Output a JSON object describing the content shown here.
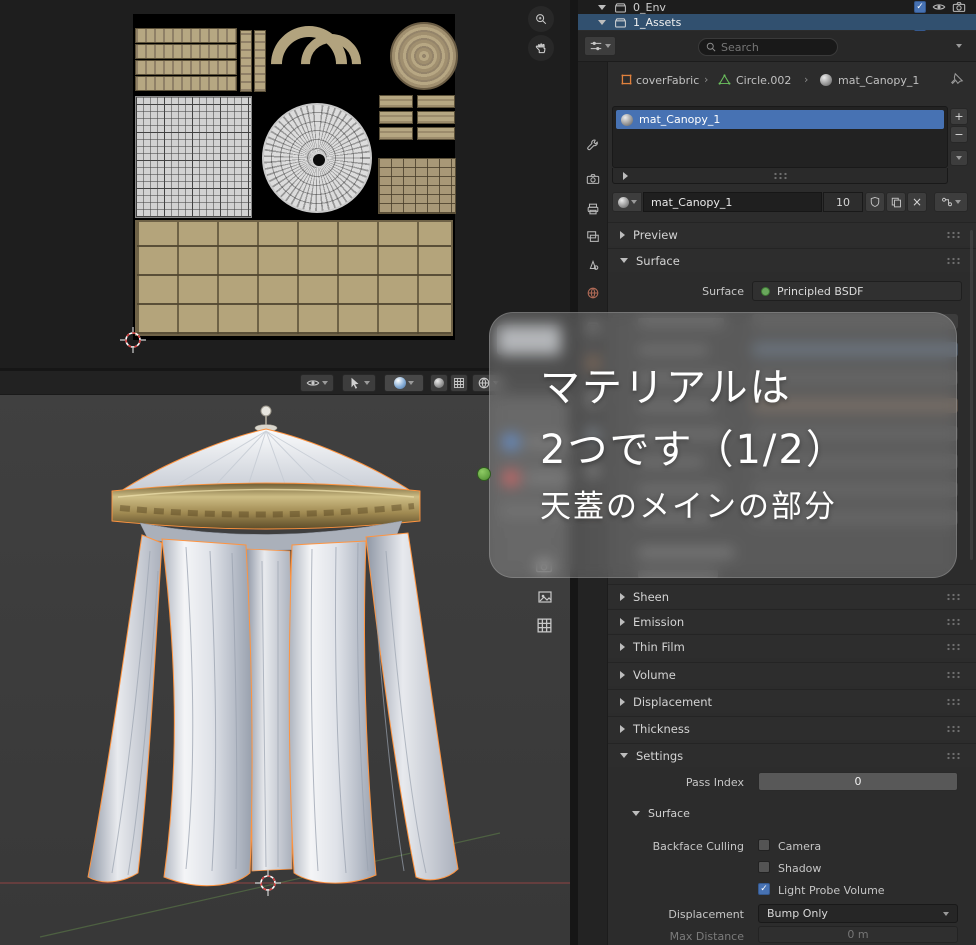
{
  "outliner": {
    "env_label": "0_Env",
    "assets_label": "1_Assets"
  },
  "header": {
    "search_placeholder": "Search"
  },
  "breadcrumb": {
    "object": "coverFabric",
    "mesh": "Circle.002",
    "material": "mat_Canopy_1",
    "separator": "›"
  },
  "slots": {
    "selected": "mat_Canopy_1"
  },
  "datablock": {
    "name": "mat_Canopy_1",
    "users": "10"
  },
  "icons": {
    "check": "✓",
    "plus": "+",
    "minus": "−",
    "close": "×"
  },
  "panels": {
    "preview": "Preview",
    "surface": "Surface",
    "sheen": "Sheen",
    "emission": "Emission",
    "thin_film": "Thin Film",
    "volume": "Volume",
    "displacement": "Displacement",
    "thickness": "Thickness",
    "settings": "Settings"
  },
  "surface": {
    "label": "Surface",
    "shader": "Principled BSDF"
  },
  "settings": {
    "pass_index_label": "Pass Index",
    "pass_index_value": "0",
    "subpanel": "Surface",
    "backface_culling": "Backface Culling",
    "camera": "Camera",
    "shadow": "Shadow",
    "light_probe_volume": "Light Probe Volume",
    "displacement_label": "Displacement",
    "displacement_value": "Bump Only",
    "max_distance_label": "Max Distance",
    "max_distance_value": "0 m"
  },
  "overlay": {
    "line1": "マテリアルは",
    "line2": "2つです（1/2）",
    "line3": "天蓋のメインの部分"
  },
  "colors": {
    "selection_blue": "#4772b3",
    "outline_orange": "#ff9440",
    "gold": "#cdbd85"
  }
}
